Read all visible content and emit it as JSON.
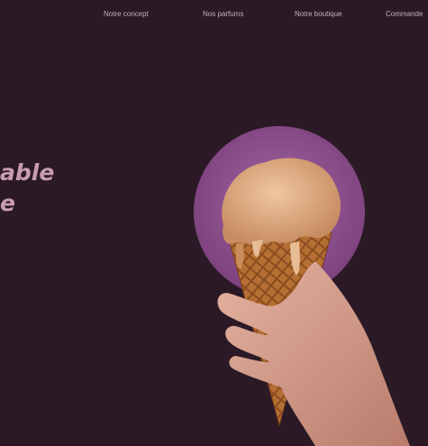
{
  "nav": {
    "items": [
      {
        "label": "Notre concept"
      },
      {
        "label": "Nos parfums"
      },
      {
        "label": "Notre boutique"
      },
      {
        "label": "Commande"
      }
    ]
  },
  "hero": {
    "headline_lines": [
      "able",
      "e"
    ],
    "image_icon": "ice-cream-cone-in-hand",
    "colors": {
      "background": "#2b1a26",
      "accent_circle": "#8e4f8f",
      "headline": "#c89cb2",
      "nav_text": "#c9aebd"
    }
  }
}
